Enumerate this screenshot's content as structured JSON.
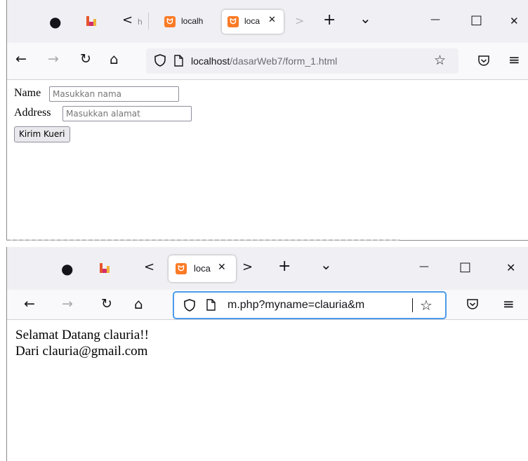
{
  "window1": {
    "tabs": [
      {
        "label": "h"
      },
      {
        "label": "localh"
      },
      {
        "label": "loca"
      }
    ],
    "url": {
      "host": "localhost",
      "path": "/dasarWeb7/form_1.html"
    },
    "form": {
      "name_label": "Name",
      "name_placeholder": "Masukkan nama",
      "address_label": "Address",
      "address_placeholder": "Masukkan alamat",
      "submit_label": "Kirim Kueri"
    }
  },
  "window2": {
    "tabs": [
      {
        "label": "loca"
      }
    ],
    "url": {
      "text": "m.php?myname=clauria&m"
    },
    "content": {
      "line1": "Selamat Datang clauria!!",
      "line2": "Dari clauria@gmail.com"
    }
  },
  "icons": {
    "github": "●",
    "back": "←",
    "forward": "→",
    "reload": "↻",
    "home": "⌂",
    "star": "☆",
    "menu": "≡",
    "close": "✕",
    "maximize": "□",
    "minimize": "—",
    "new_tab": "+",
    "list_tabs": "⌄",
    "scroll_left": "<",
    "scroll_right": ">"
  },
  "colors": {
    "accent": "#4c9bea",
    "xampp": "#fb7a24",
    "tabbar": "#f0f0f4",
    "navbar": "#f9f9fb"
  }
}
